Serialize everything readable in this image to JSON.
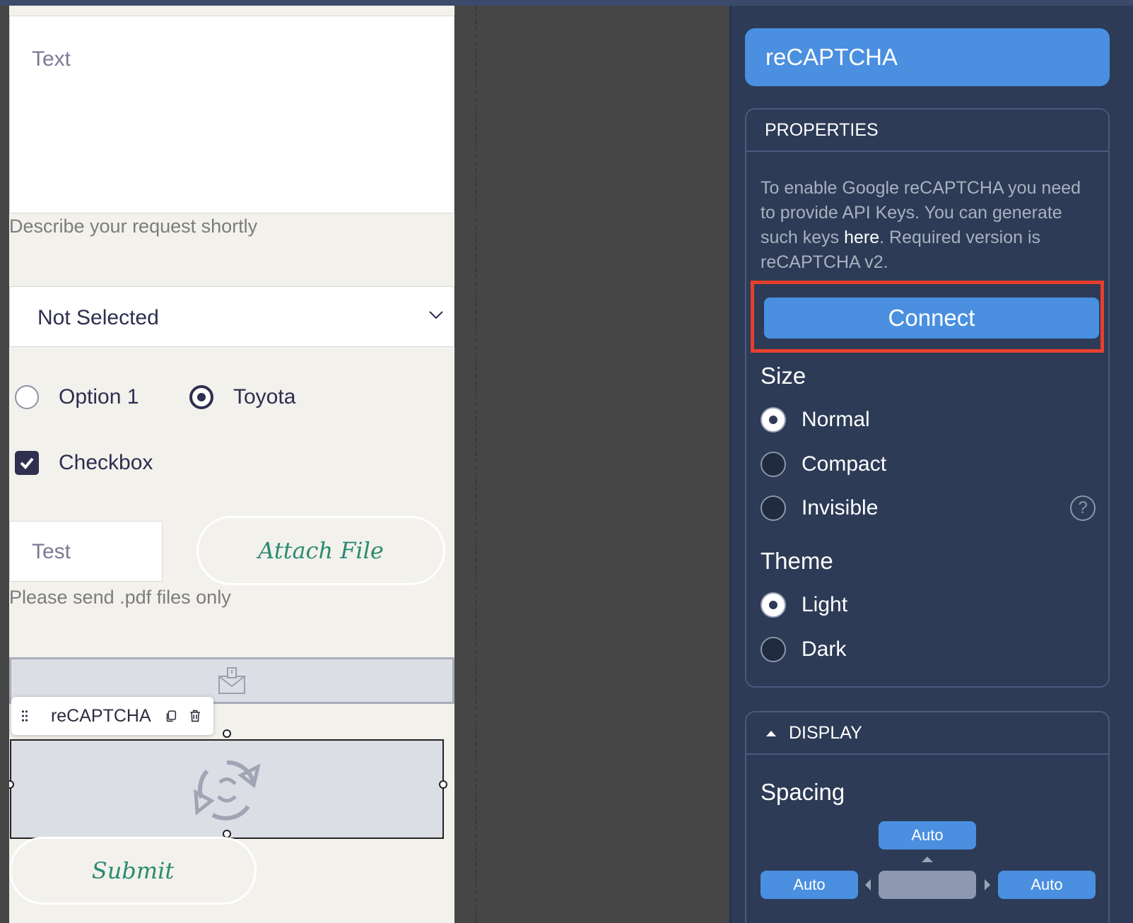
{
  "form": {
    "textarea_placeholder": "Text",
    "textarea_hint": "Describe your request shortly",
    "select_value": "Not Selected",
    "radios": [
      {
        "label": "Option 1",
        "selected": false
      },
      {
        "label": "Toyota",
        "selected": true
      }
    ],
    "checkbox_label": "Checkbox",
    "checkbox_checked": true,
    "file_input_value": "Test",
    "attach_button": "Attach File",
    "file_hint": "Please send .pdf files only",
    "toolbar_label": "reCAPTCHA",
    "submit_button": "Submit"
  },
  "panel": {
    "title": "reCAPTCHA",
    "properties_header": "PROPERTIES",
    "description_before": "To enable Google reCAPTCHA you need to provide API Keys. You can generate such keys ",
    "description_link": "here",
    "description_after": ". Required version is reCAPTCHA v2.",
    "connect_button": "Connect",
    "size_title": "Size",
    "size_options": [
      {
        "label": "Normal",
        "selected": true
      },
      {
        "label": "Compact",
        "selected": false
      },
      {
        "label": "Invisible",
        "selected": false
      }
    ],
    "help_symbol": "?",
    "theme_title": "Theme",
    "theme_options": [
      {
        "label": "Light",
        "selected": true
      },
      {
        "label": "Dark",
        "selected": false
      }
    ],
    "display_header": "DISPLAY",
    "spacing_title": "Spacing",
    "spacing": {
      "top": "Auto",
      "left": "Auto",
      "right": "Auto"
    }
  },
  "colors": {
    "accent": "#4a8fe0",
    "panel_bg": "#2d3b56",
    "highlight": "#e53f2c",
    "canvas_bg": "#f3f1ec"
  }
}
